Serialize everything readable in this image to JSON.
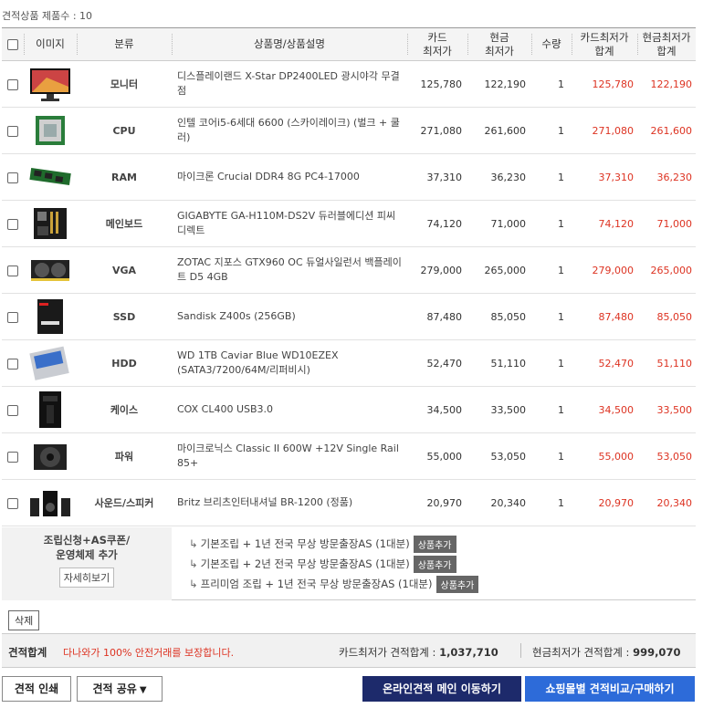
{
  "header": {
    "count_text": "견적상품 제품수 : 10"
  },
  "columns": {
    "image": "이미지",
    "category": "분류",
    "name": "상품명/상품설명",
    "card_price": "카드\n최저가",
    "cash_price": "현금\n최저가",
    "qty": "수량",
    "card_sum": "카드최저가\n합계",
    "cash_sum": "현금최저가\n합계"
  },
  "rows": [
    {
      "category": "모니터",
      "name": "디스플레이랜드 X-Star DP2400LED 광시야각 무결점",
      "card": "125,780",
      "cash": "122,190",
      "qty": "1",
      "card_sum": "125,780",
      "cash_sum": "122,190",
      "icon": "monitor-icon"
    },
    {
      "category": "CPU",
      "name": "인텔 코어i5-6세대 6600 (스카이레이크) (벌크 + 쿨러)",
      "card": "271,080",
      "cash": "261,600",
      "qty": "1",
      "card_sum": "271,080",
      "cash_sum": "261,600",
      "icon": "cpu-icon"
    },
    {
      "category": "RAM",
      "name": "마이크론 Crucial DDR4 8G PC4-17000",
      "card": "37,310",
      "cash": "36,230",
      "qty": "1",
      "card_sum": "37,310",
      "cash_sum": "36,230",
      "icon": "ram-icon"
    },
    {
      "category": "메인보드",
      "name": "GIGABYTE GA-H110M-DS2V 듀러블에디션 피씨디렉트",
      "card": "74,120",
      "cash": "71,000",
      "qty": "1",
      "card_sum": "74,120",
      "cash_sum": "71,000",
      "icon": "motherboard-icon"
    },
    {
      "category": "VGA",
      "name": "ZOTAC 지포스 GTX960 OC 듀얼사일런서 백플레이트 D5 4GB",
      "card": "279,000",
      "cash": "265,000",
      "qty": "1",
      "card_sum": "279,000",
      "cash_sum": "265,000",
      "icon": "graphics-card-icon"
    },
    {
      "category": "SSD",
      "name": "Sandisk Z400s (256GB)",
      "card": "87,480",
      "cash": "85,050",
      "qty": "1",
      "card_sum": "87,480",
      "cash_sum": "85,050",
      "icon": "ssd-icon"
    },
    {
      "category": "HDD",
      "name": "WD 1TB Caviar Blue WD10EZEX (SATA3/7200/64M/리퍼비시)",
      "card": "52,470",
      "cash": "51,110",
      "qty": "1",
      "card_sum": "52,470",
      "cash_sum": "51,110",
      "icon": "hdd-icon"
    },
    {
      "category": "케이스",
      "name": "COX CL400 USB3.0",
      "card": "34,500",
      "cash": "33,500",
      "qty": "1",
      "card_sum": "34,500",
      "cash_sum": "33,500",
      "icon": "case-icon"
    },
    {
      "category": "파워",
      "name": "마이크로닉스 Classic II 600W +12V Single Rail 85+",
      "card": "55,000",
      "cash": "53,050",
      "qty": "1",
      "card_sum": "55,000",
      "cash_sum": "53,050",
      "icon": "power-supply-icon"
    },
    {
      "category": "사운드/스피커",
      "name": "Britz 브리츠인터내셔널 BR-1200 (정품)",
      "card": "20,970",
      "cash": "20,340",
      "qty": "1",
      "card_sum": "20,970",
      "cash_sum": "20,340",
      "icon": "speakers-icon"
    }
  ],
  "addons": {
    "title": "조립신청+AS쿠폰/\n운영체제 추가",
    "more_label": "자세히보기",
    "options": [
      {
        "text": "기본조립 + 1년 전국 무상 방문출장AS (1대분)",
        "button": "상품추가"
      },
      {
        "text": "기본조립 + 2년 전국 무상 방문출장AS (1대분)",
        "button": "상품추가"
      },
      {
        "text": "프리미엄 조립 + 1년 전국 무상 방문출장AS (1대분)",
        "button": "상품추가"
      }
    ]
  },
  "delete_label": "삭제",
  "summary": {
    "label": "견적합계",
    "safe_text": "다나와가 100% 안전거래를 보장합니다.",
    "card_label": "카드최저가 견적합계 : ",
    "card_total": "1,037,710",
    "cash_label": "현금최저가 견적합계 : ",
    "cash_total": "999,070"
  },
  "buttons": {
    "print": "견적 인쇄",
    "share": "견적 공유",
    "main": "온라인견적 메인 이동하기",
    "compare": "쇼핑몰별 견적비교/구매하기"
  },
  "colors": {
    "red": "#dd3322",
    "navy": "#1d2a6b",
    "blue": "#2d6bd9"
  }
}
